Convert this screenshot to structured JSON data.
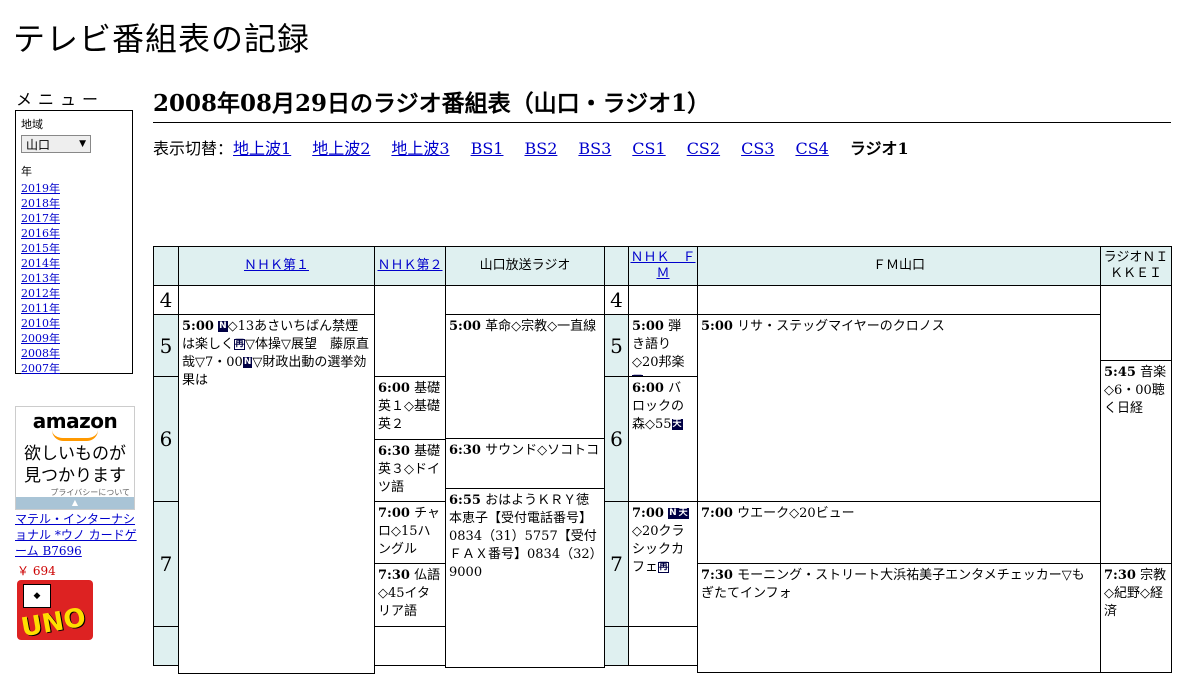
{
  "site": {
    "title": "テレビ番組表の記録"
  },
  "menu": {
    "title": "メニュー",
    "region_label": "地域",
    "region_value": "山口",
    "year_label": "年",
    "years": [
      "2019年",
      "2018年",
      "2017年",
      "2016年",
      "2015年",
      "2014年",
      "2013年",
      "2012年",
      "2011年",
      "2010年",
      "2009年",
      "2008年",
      "2007年"
    ]
  },
  "ad": {
    "brand": "amazon",
    "tagline_1": "欲しいものが",
    "tagline_2": "見つかります",
    "privacy": "プライバシーについて",
    "product_title": "マテル・インターナショナル *ウノ カードゲーム B7696",
    "product_price": "￥ 694",
    "product_image_text": "UNO"
  },
  "page": {
    "heading": "2008年08月29日のラジオ番組表（山口・ラジオ1）"
  },
  "switcher": {
    "label": "表示切替：",
    "links": [
      "地上波1",
      "地上波2",
      "地上波3",
      "BS1",
      "BS2",
      "BS3",
      "CS1",
      "CS2",
      "CS3",
      "CS4"
    ],
    "current": "ラジオ1"
  },
  "stations": [
    "ＮＨＫ第１",
    "ＮＨＫ第２",
    "山口放送ラジオ",
    "ＮＨＫ　ＦＭ",
    "ＦＭ山口",
    "ラジオＮＩＫＫＥＩ"
  ],
  "hours": [
    "4",
    "5",
    "6",
    "7"
  ],
  "programs": {
    "nhk1_500": {
      "time": "5:00",
      "a": "◇13あさいちばん禁煙は楽しく",
      "b": "▽体操▽展望　藤原直哉▽7・00",
      "c": "▽財政出動の選挙効果は"
    },
    "nhk2_600": {
      "time": "6:00",
      "text": "基礎英１◇基礎英２"
    },
    "nhk2_630": {
      "time": "6:30",
      "text": "基礎英３◇ドイツ語"
    },
    "nhk2_700": {
      "time": "7:00",
      "text": "チャロ◇15ハングル"
    },
    "nhk2_730": {
      "time": "7:30",
      "text": "仏語◇45イタリア語"
    },
    "kry_500": {
      "time": "5:00",
      "text": "革命◇宗教◇一直線"
    },
    "kry_630": {
      "time": "6:30",
      "text": "サウンド◇ソコトコ"
    },
    "kry_655": {
      "time": "6:55",
      "text": "おはようＫＲＹ徳本恵子【受付電話番号】0834（31）5757【受付ＦＡＸ番号】0834（32）9000"
    },
    "fm_500": {
      "time": "5:00",
      "text": "弾き語り◇20邦楽"
    },
    "fm_600": {
      "time": "6:00",
      "text": "バロックの森◇55"
    },
    "fm_700": {
      "time": "7:00",
      "text": "◇20クラシックカフェ"
    },
    "fmy_500": {
      "time": "5:00",
      "text": "リサ・ステッグマイヤーのクロノス"
    },
    "fmy_700": {
      "time": "7:00",
      "text": "ウエーク◇20ビュー"
    },
    "fmy_730": {
      "time": "7:30",
      "text": "モーニング・ストリート大浜祐美子エンタメチェッカー▽もぎたてインフォ"
    },
    "nikkei_545": {
      "time": "5:45",
      "text": "音楽◇6・00聴く日経"
    },
    "nikkei_730": {
      "time": "7:30",
      "text": "宗教◇紀野◇経済"
    }
  },
  "tags": {
    "news": "N",
    "rebroadcast": "再",
    "stereo": "天"
  }
}
